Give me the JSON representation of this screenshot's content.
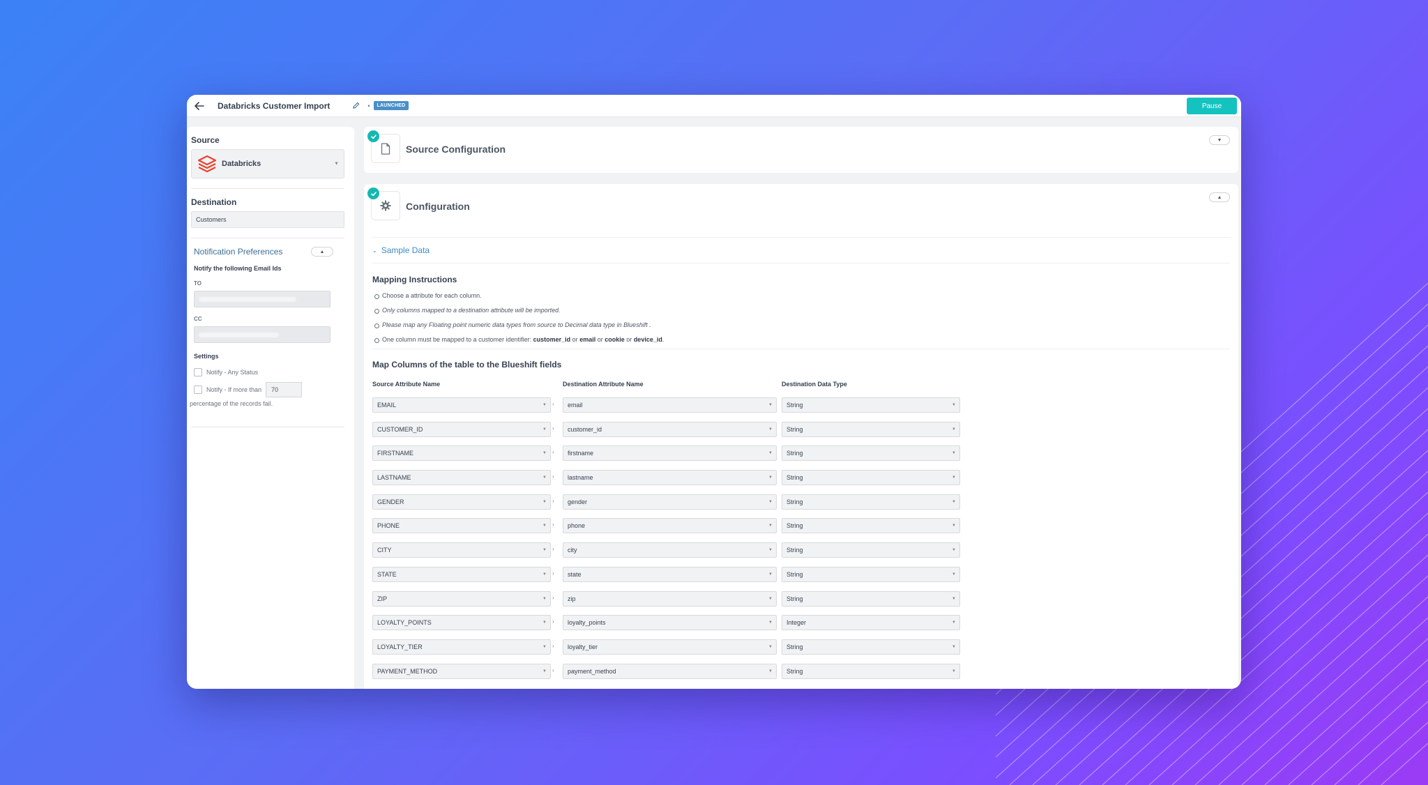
{
  "header": {
    "title": "Databricks Customer Import",
    "status": "LAUNCHED",
    "pause_label": "Pause"
  },
  "sidebar": {
    "source_label": "Source",
    "source_value": "Databricks",
    "destination_label": "Destination",
    "destination_value": "Customers",
    "notifications": {
      "title": "Notification Preferences",
      "subtitle": "Notify the following Email Ids",
      "to_label": "TO",
      "cc_label": "CC",
      "settings_label": "Settings",
      "any_status_label": "Notify - Any Status",
      "if_more_label": "Notify - If more than",
      "threshold_value": "70",
      "percentage_note": "percentage of the records fail."
    }
  },
  "source_card": {
    "title": "Source Configuration"
  },
  "config_card": {
    "title": "Configuration",
    "sample_data_label": "Sample Data",
    "instructions_title": "Mapping Instructions",
    "instruction_1": "Choose a attribute for each column.",
    "instruction_2": "Only columns mapped to a destination attribute will be imported.",
    "instruction_3": "Please map any Floating point numeric data types from source to Decimal data type in Blueshift .",
    "instruction_4_prefix": "One column must be mapped to a customer identifier: ",
    "id_customer": "customer_id",
    "id_email": "email",
    "id_cookie": "cookie",
    "id_device": "device_id",
    "or_word": "or",
    "map_title": "Map Columns of the table to the Blueshift fields",
    "headers": {
      "source": "Source Attribute Name",
      "destination": "Destination Attribute Name",
      "type": "Destination Data Type"
    },
    "rows": [
      {
        "source": "EMAIL",
        "destination": "email",
        "type": "String"
      },
      {
        "source": "CUSTOMER_ID",
        "destination": "customer_id",
        "type": "String"
      },
      {
        "source": "FIRSTNAME",
        "destination": "firstname",
        "type": "String"
      },
      {
        "source": "LASTNAME",
        "destination": "lastname",
        "type": "String"
      },
      {
        "source": "GENDER",
        "destination": "gender",
        "type": "String"
      },
      {
        "source": "PHONE",
        "destination": "phone",
        "type": "String"
      },
      {
        "source": "CITY",
        "destination": "city",
        "type": "String"
      },
      {
        "source": "STATE",
        "destination": "state",
        "type": "String"
      },
      {
        "source": "ZIP",
        "destination": "zip",
        "type": "String"
      },
      {
        "source": "LOYALTY_POINTS",
        "destination": "loyalty_points",
        "type": "Integer"
      },
      {
        "source": "LOYALTY_TIER",
        "destination": "loyalty_tier",
        "type": "String"
      },
      {
        "source": "PAYMENT_METHOD",
        "destination": "payment_method",
        "type": "String"
      }
    ]
  },
  "colors": {
    "accent": "#14c3c0",
    "badge": "#4a90c8",
    "link": "#3b8dc0",
    "databricks": "#e8432f"
  },
  "icons": {
    "back": "arrow-left-icon",
    "edit": "pencil-icon",
    "source": "document-icon",
    "config": "gear-icon",
    "done": "check-circle-icon"
  }
}
